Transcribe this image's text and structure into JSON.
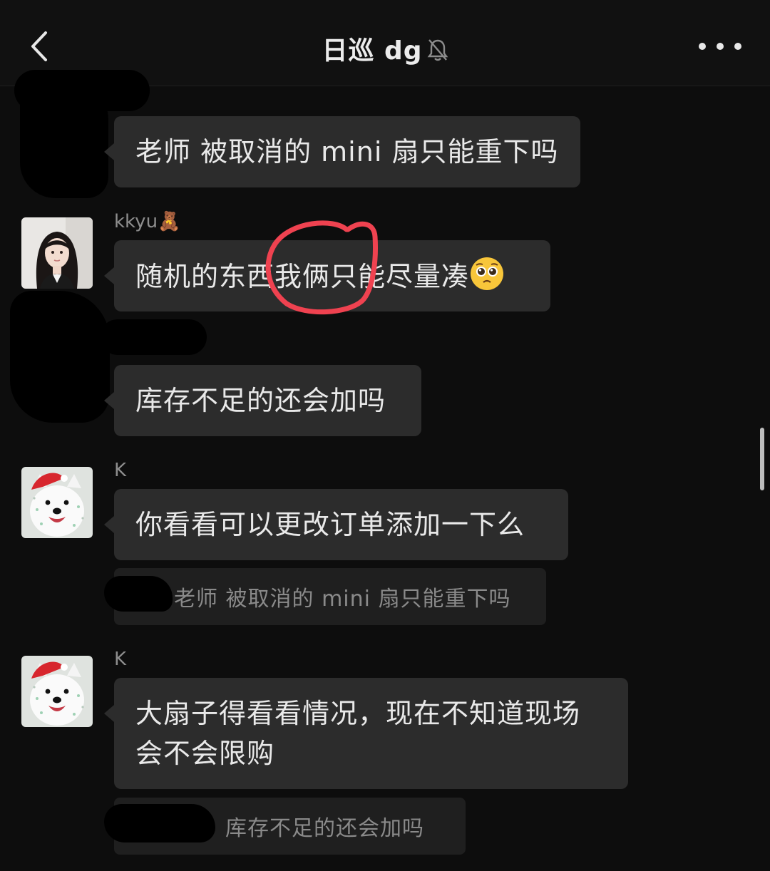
{
  "header": {
    "title": "日巡 dg",
    "back_icon": "chevron-left-icon",
    "mute_icon": "bell-slash-icon",
    "more_icon": "more-dots-icon"
  },
  "messages": [
    {
      "sender": "",
      "text": "老师 被取消的 mini 扇只能重下吗"
    },
    {
      "sender": "kkyu🧸",
      "text": "随机的东西我俩只能尽量凑",
      "emoji": "pleading-face-emoji"
    },
    {
      "sender": "",
      "text": "库存不足的还会加吗"
    },
    {
      "sender": "K",
      "text": "你看看可以更改订单添加一下么",
      "quote": "老师 被取消的 mini 扇只能重下吗"
    },
    {
      "sender": "K",
      "text": "大扇子得看看情况，现在不知道现场会不会限购",
      "text_line1": "大扇子得看看情况，现在不知道现场",
      "text_line2": "会不会限购",
      "quote": "库存不足的还会加吗"
    }
  ],
  "colors": {
    "background": "#0d0d0d",
    "bubble": "#2c2c2c",
    "annotation": "#ef4250"
  }
}
